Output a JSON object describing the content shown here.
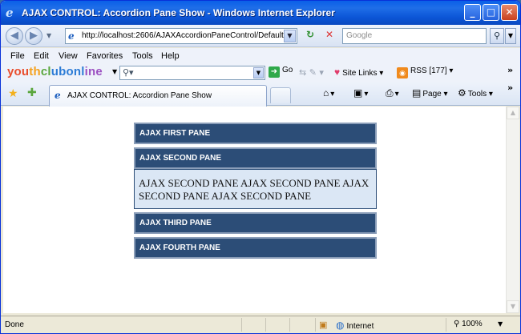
{
  "window": {
    "title": "AJAX CONTROL: Accordion Pane Show - Windows Internet Explorer",
    "minimize": "_",
    "maximize": "□",
    "close": "✕"
  },
  "address": {
    "url": "http://localhost:2606/AJAXAccordionPaneControl/Default",
    "search_placeholder": "Google"
  },
  "menu": [
    "File",
    "Edit",
    "View",
    "Favorites",
    "Tools",
    "Help"
  ],
  "toolbar": {
    "brand_parts": [
      "you",
      "th",
      "cl",
      "ubonl",
      "ine"
    ],
    "go_label": "Go",
    "site_links_label": "Site Links",
    "rss_label": "RSS [177]"
  },
  "tabs": {
    "active_tab_label": "AJAX CONTROL: Accordion Pane Show",
    "page_label": "Page",
    "tools_label": "Tools"
  },
  "accordion": {
    "panes": [
      {
        "header": "AJAX FIRST PANE"
      },
      {
        "header": "AJAX SECOND PANE",
        "content": "AJAX SECOND PANE AJAX SECOND PANE AJAX SECOND PANE AJAX SECOND PANE"
      },
      {
        "header": "AJAX THIRD PANE"
      },
      {
        "header": "AJAX FOURTH PANE"
      }
    ],
    "open_pane_index": 1,
    "header_color": "#2c4d77",
    "body_color": "#dbe7f5"
  },
  "status": {
    "text": "Done",
    "zone": "Internet",
    "zoom": "100%"
  }
}
